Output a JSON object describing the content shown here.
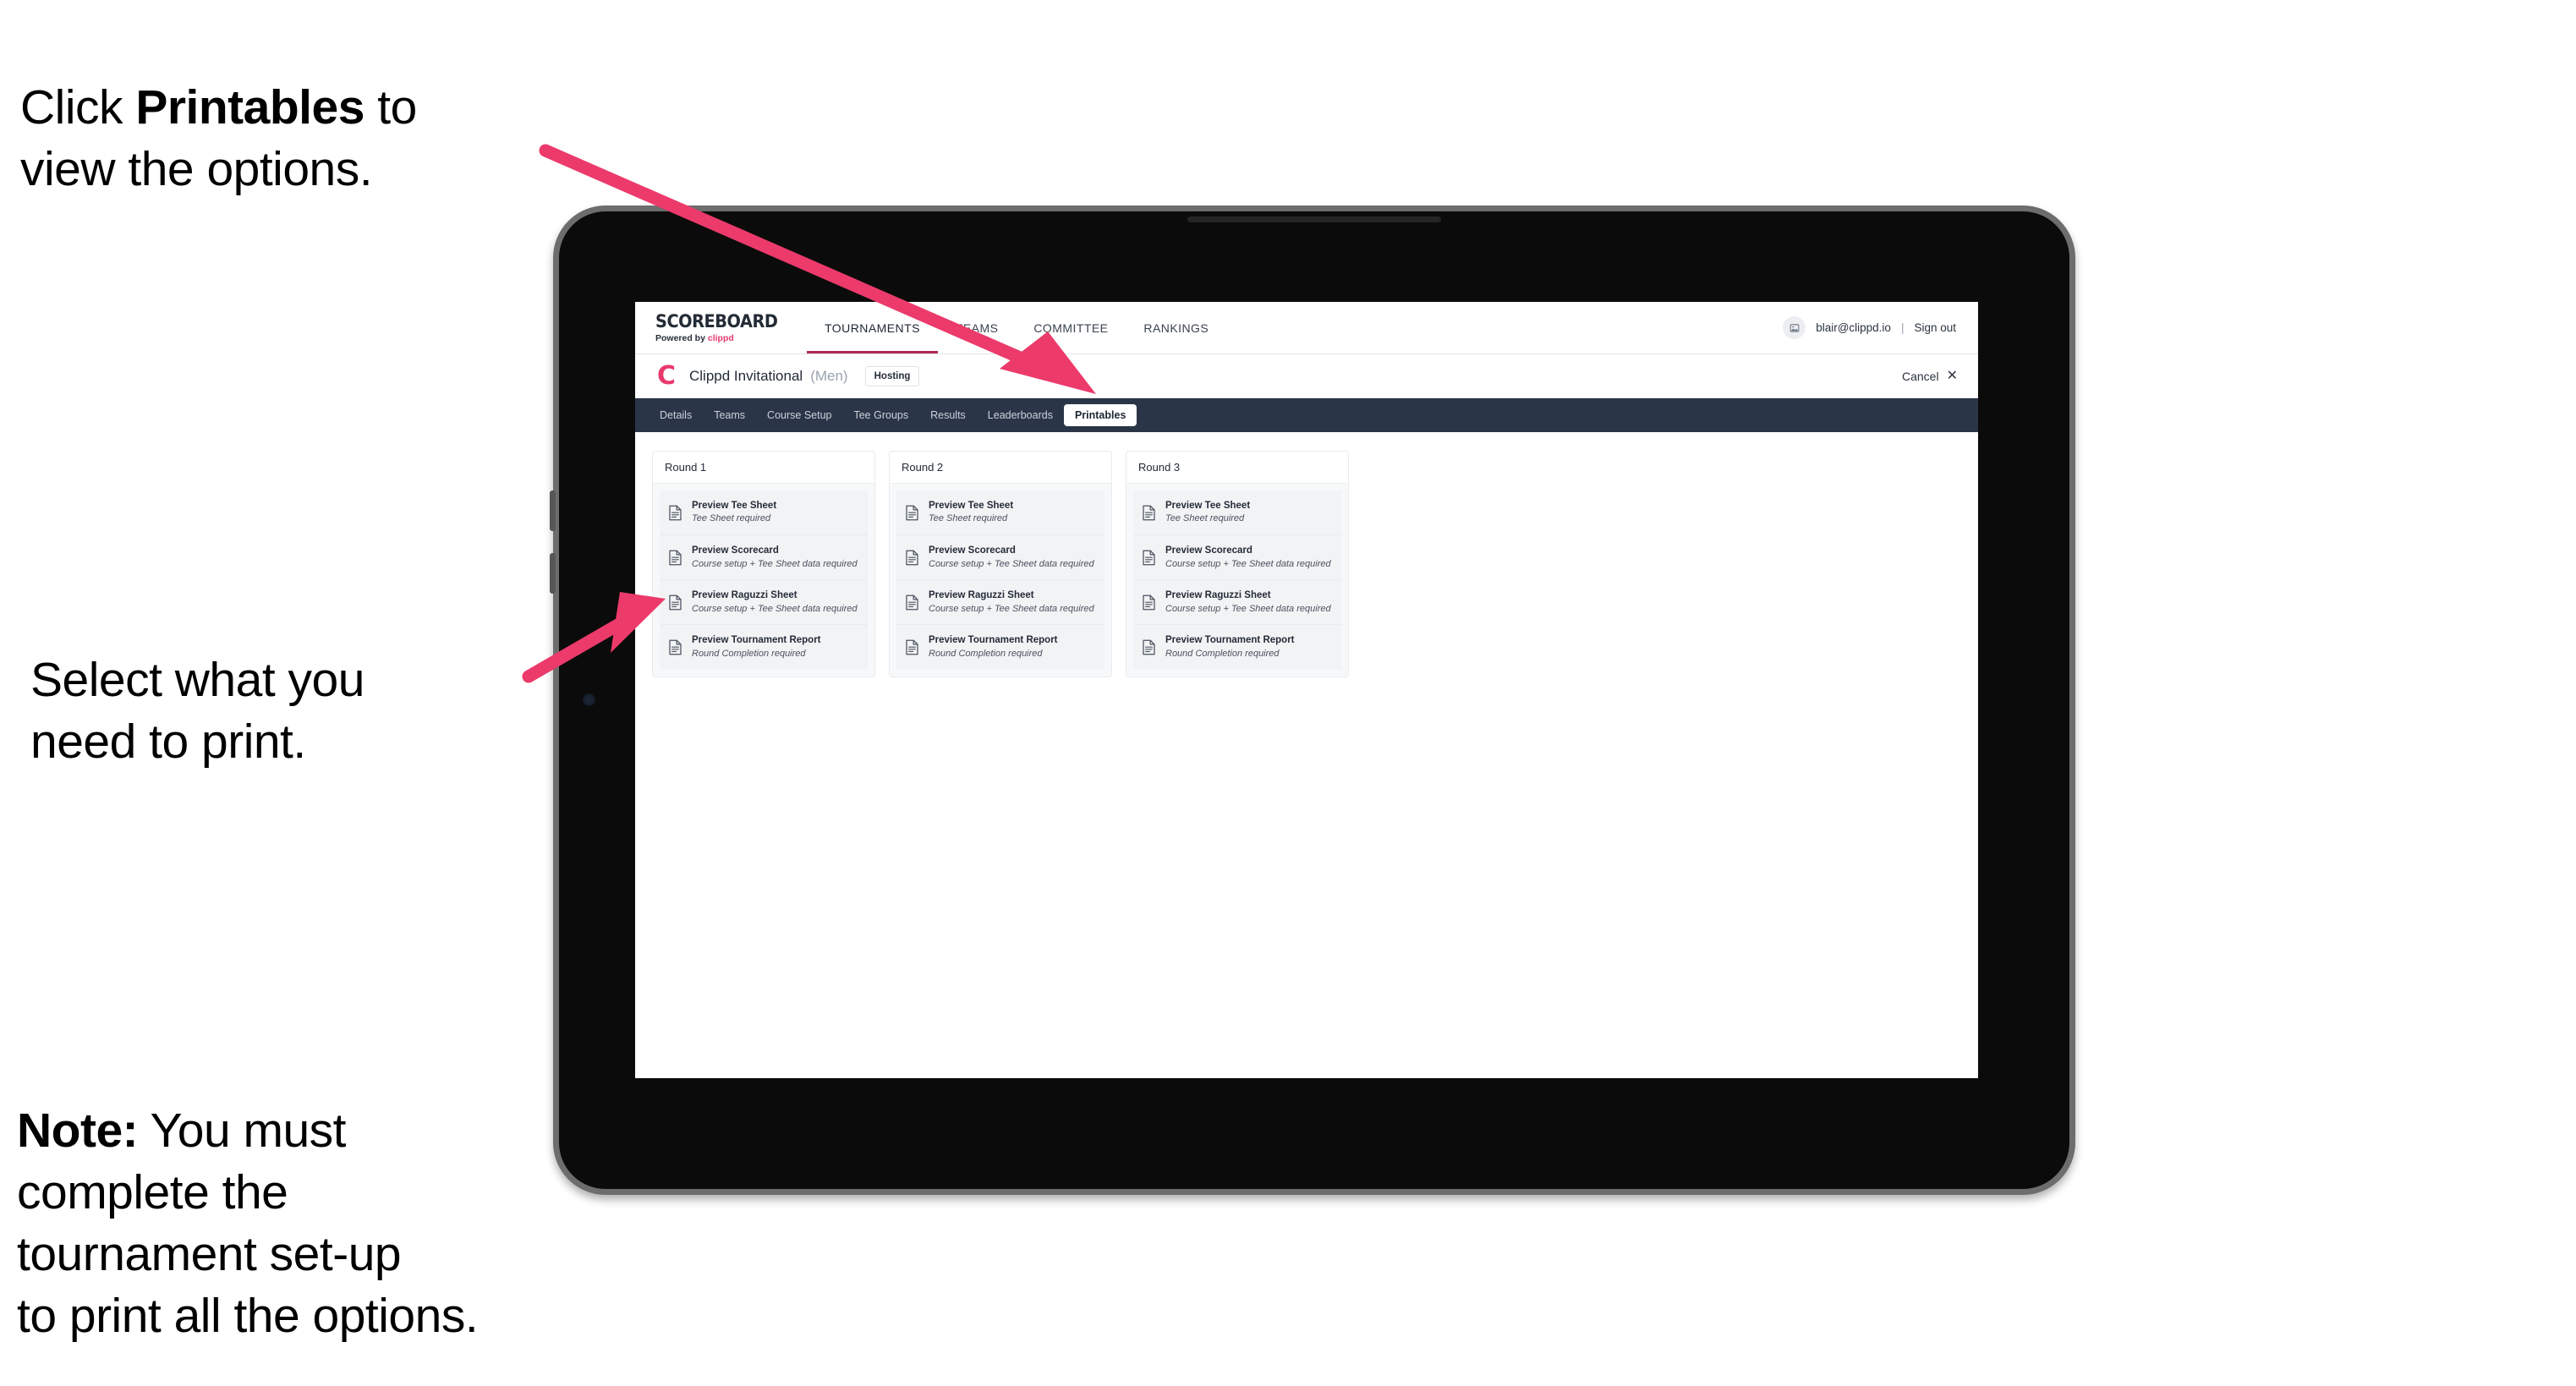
{
  "annotations": {
    "click_printables": "Click Printables to\nview the options.",
    "click_printables_bold": "Printables",
    "select_print": "Select what you\n need to print.",
    "note_bold": "Note:",
    "note_rest": " You must\ncomplete the\ntournament set-up\nto print all the options."
  },
  "colors": {
    "accent_pink": "#e8396c",
    "arrow_pink": "#ec3a6b",
    "subnav_navy": "#2a3547",
    "active_underline": "#b02a52",
    "device_frame": "#6d6d6d",
    "device_body": "#0b0b0b"
  },
  "app": {
    "brand": {
      "title": "SCOREBOARD",
      "powered_prefix": "Powered by ",
      "powered_name": "clippd"
    },
    "mainnav": [
      {
        "label": "TOURNAMENTS",
        "active": true
      },
      {
        "label": "TEAMS",
        "active": false
      },
      {
        "label": "COMMITTEE",
        "active": false
      },
      {
        "label": "RANKINGS",
        "active": false
      }
    ],
    "topbar_right": {
      "avatar_icon": "user-avatar-icon",
      "email": "blair@clippd.io",
      "separator": "|",
      "sign_out": "Sign out"
    },
    "tournament": {
      "logo_letter": "C",
      "name": "Clippd Invitational",
      "gender": "(Men)",
      "status_badge": "Hosting",
      "cancel_label": "Cancel",
      "cancel_icon": "close-icon"
    },
    "subnav": [
      {
        "label": "Details",
        "active": false
      },
      {
        "label": "Teams",
        "active": false
      },
      {
        "label": "Course Setup",
        "active": false
      },
      {
        "label": "Tee Groups",
        "active": false
      },
      {
        "label": "Results",
        "active": false
      },
      {
        "label": "Leaderboards",
        "active": false
      },
      {
        "label": "Printables",
        "active": true
      }
    ],
    "rounds": [
      {
        "title": "Round 1",
        "items": [
          {
            "title": "Preview Tee Sheet",
            "sub": "Tee Sheet required"
          },
          {
            "title": "Preview Scorecard",
            "sub": "Course setup + Tee Sheet data required"
          },
          {
            "title": "Preview Raguzzi Sheet",
            "sub": "Course setup + Tee Sheet data required"
          },
          {
            "title": "Preview Tournament Report",
            "sub": "Round Completion required"
          }
        ]
      },
      {
        "title": "Round 2",
        "items": [
          {
            "title": "Preview Tee Sheet",
            "sub": "Tee Sheet required"
          },
          {
            "title": "Preview Scorecard",
            "sub": "Course setup + Tee Sheet data required"
          },
          {
            "title": "Preview Raguzzi Sheet",
            "sub": "Course setup + Tee Sheet data required"
          },
          {
            "title": "Preview Tournament Report",
            "sub": "Round Completion required"
          }
        ]
      },
      {
        "title": "Round 3",
        "items": [
          {
            "title": "Preview Tee Sheet",
            "sub": "Tee Sheet required"
          },
          {
            "title": "Preview Scorecard",
            "sub": "Course setup + Tee Sheet data required"
          },
          {
            "title": "Preview Raguzzi Sheet",
            "sub": "Course setup + Tee Sheet data required"
          },
          {
            "title": "Preview Tournament Report",
            "sub": "Round Completion required"
          }
        ]
      }
    ]
  }
}
